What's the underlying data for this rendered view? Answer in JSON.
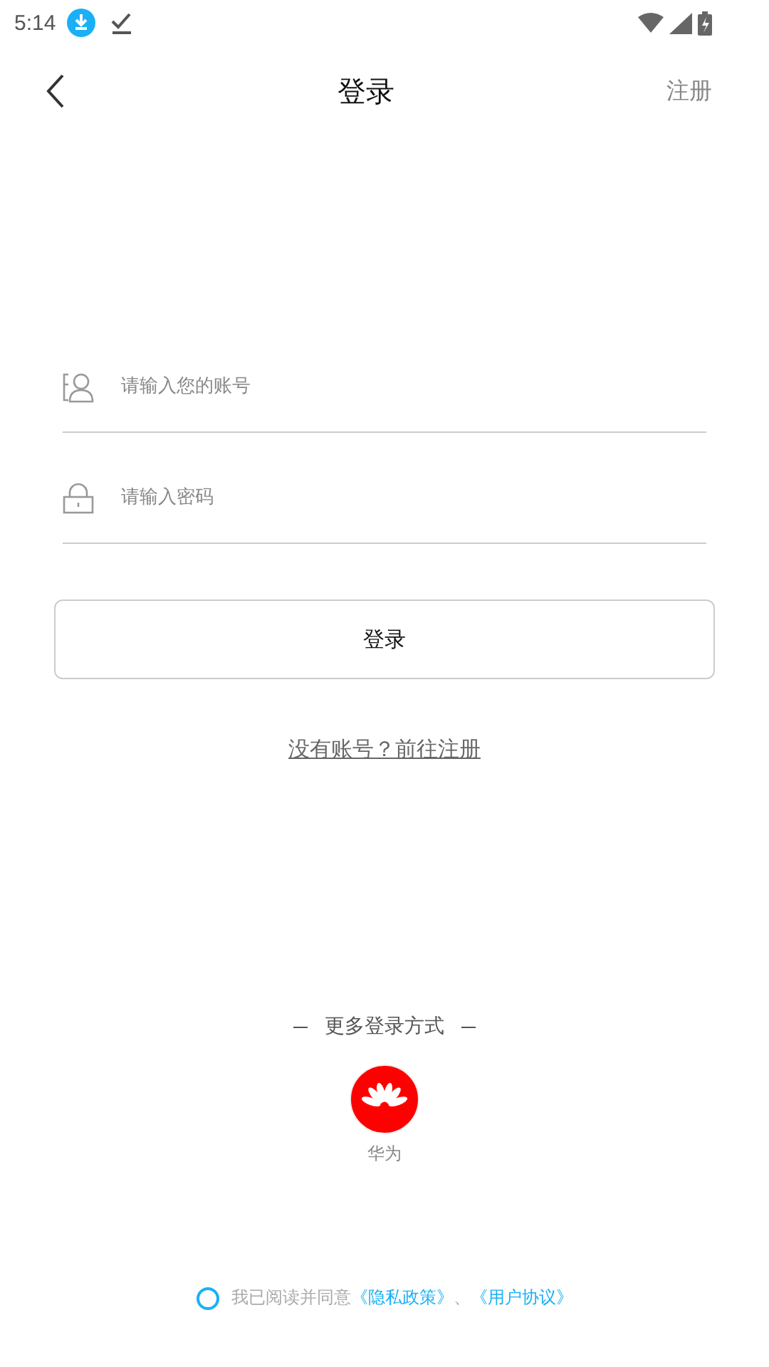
{
  "status_bar": {
    "time": "5:14"
  },
  "header": {
    "title": "登录",
    "action": "注册"
  },
  "fields": [
    {
      "kind": "account",
      "placeholder": "请输入您的账号"
    },
    {
      "kind": "password",
      "placeholder": "请输入密码"
    }
  ],
  "login_button": "登录",
  "register_link": "没有账号？前往注册",
  "more_login": {
    "title": "更多登录方式",
    "providers": [
      {
        "label": "华为"
      }
    ]
  },
  "agreement": {
    "checked": false,
    "text": "我已阅读并同意",
    "links": [
      "《隐私政策》",
      "《用户协议》"
    ],
    "separator": "、"
  }
}
